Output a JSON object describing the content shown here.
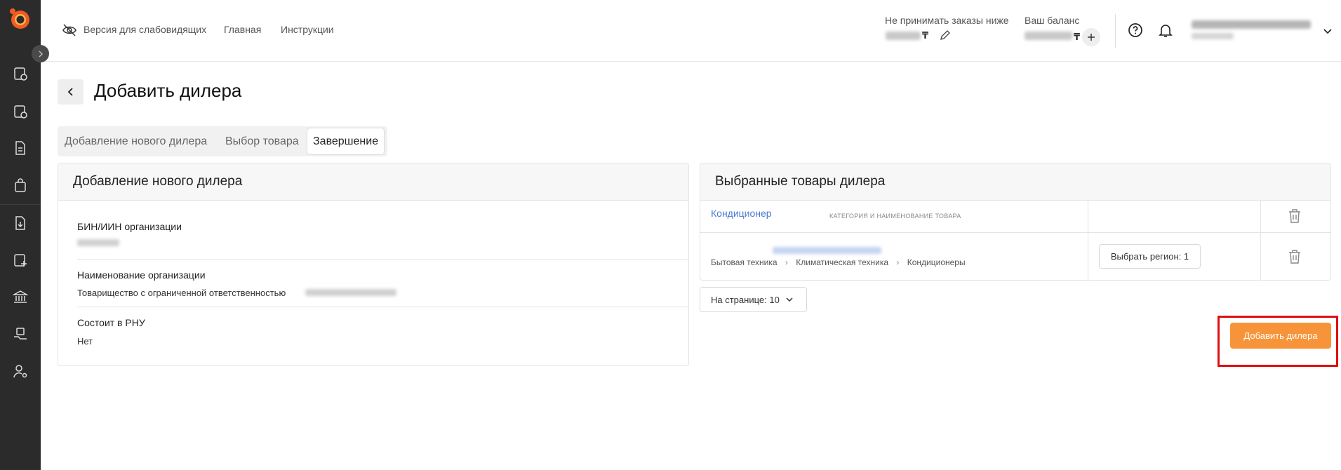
{
  "header": {
    "accessibility_label": "Версия для слабовидящих",
    "nav": [
      "Главная",
      "Инструкции"
    ],
    "min_order_label": "Не принимать заказы ниже",
    "balance_label": "Ваш баланс",
    "currency": "₸"
  },
  "page": {
    "title": "Добавить дилера"
  },
  "steps": [
    {
      "label": "Добавление нового дилера",
      "active": false
    },
    {
      "label": "Выбор товара",
      "active": false
    },
    {
      "label": "Завершение",
      "active": true
    }
  ],
  "dealer_card": {
    "title": "Добавление нового дилера",
    "fields": [
      {
        "label": "БИН/ИИН организации",
        "value": ""
      },
      {
        "label": "Наименование организации",
        "value": "Товарищество с ограниченной ответственностью"
      },
      {
        "label": "Состоит в РНУ",
        "value": "Нет"
      }
    ]
  },
  "products_card": {
    "title": "Выбранные товары дилера",
    "column_header": "КАТЕГОРИЯ И НАИМЕНОВАНИЕ ТОВАРА",
    "rows": [
      {
        "name": "Кондиционер",
        "breadcrumb": [
          "Бытовая техника",
          "Климатическая техника",
          "Кондиционеры"
        ],
        "region_button": "Выбрать регион: 1"
      }
    ],
    "per_page": "На странице: 10"
  },
  "actions": {
    "add_dealer": "Добавить дилера"
  }
}
